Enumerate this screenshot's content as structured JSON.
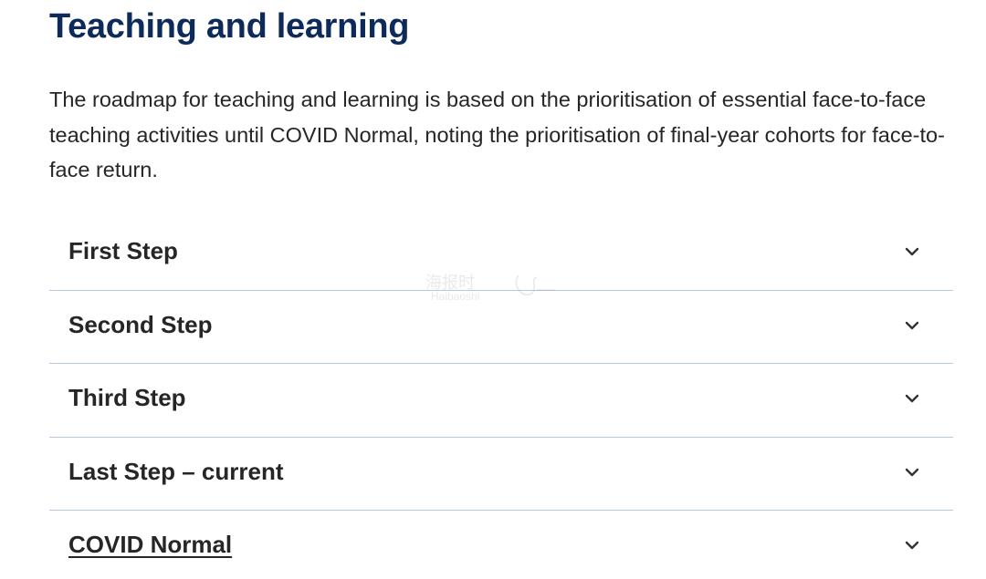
{
  "page": {
    "title": "Teaching and learning",
    "intro": "The roadmap for teaching and learning is based on the prioritisation of essential face-to-face teaching activities until COVID Normal, noting the prioritisation of final-year cohorts for face-to-face return."
  },
  "accordion": {
    "items": [
      {
        "label": "First Step",
        "icon": "chevron-down-icon"
      },
      {
        "label": "Second Step",
        "icon": "chevron-down-icon"
      },
      {
        "label": "Third Step",
        "icon": "chevron-down-icon"
      },
      {
        "label": "Last Step – current",
        "icon": "chevron-down-icon"
      },
      {
        "label": "COVID Normal",
        "icon": "chevron-down-icon"
      }
    ]
  },
  "watermark": {
    "text": "海报时",
    "sub": "Haibaoshi"
  },
  "colors": {
    "title": "#0d2a5a",
    "text": "#262626",
    "divider": "#b9c9dd",
    "chevron": "#333333"
  }
}
